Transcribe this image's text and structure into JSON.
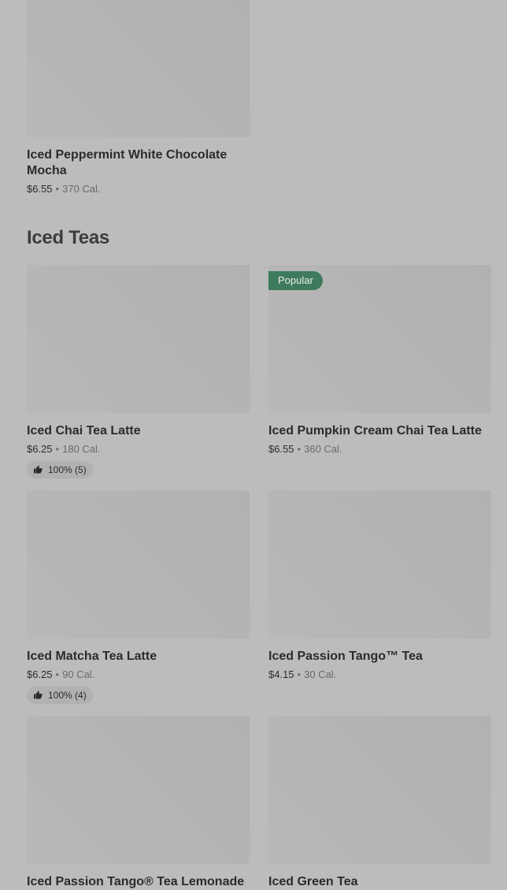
{
  "colors": {
    "background": "#bcbcbc",
    "badge_popular": "#3e7b5c",
    "image_placeholder": "#b5b5b5"
  },
  "previous_section": {
    "items": [
      {
        "name": "Iced Peppermint White Chocolate Mocha",
        "price": "$6.55",
        "calories": "370 Cal."
      }
    ]
  },
  "section": {
    "title": "Iced Teas",
    "items": [
      {
        "name": "Iced Chai Tea Latte",
        "price": "$6.25",
        "calories": "180 Cal.",
        "rating": "100% (5)",
        "rating_icon": "thumbs-up-icon"
      },
      {
        "name": "Iced Pumpkin Cream Chai Tea Latte",
        "price": "$6.55",
        "calories": "360 Cal.",
        "badge": "Popular"
      },
      {
        "name": "Iced Matcha Tea Latte",
        "price": "$6.25",
        "calories": "90 Cal.",
        "rating": "100% (4)",
        "rating_icon": "thumbs-up-icon"
      },
      {
        "name": "Iced Passion Tango™ Tea",
        "price": "$4.15",
        "calories": "30 Cal."
      },
      {
        "name": "Iced Passion Tango® Tea Lemonade"
      },
      {
        "name": "Iced Green Tea"
      }
    ]
  }
}
